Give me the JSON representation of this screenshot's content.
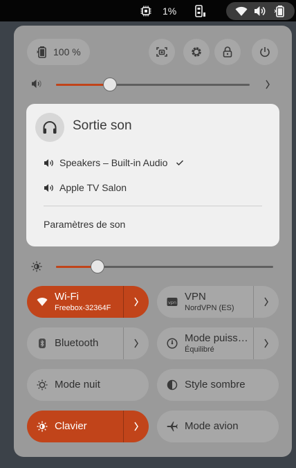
{
  "topbar": {
    "battery_percent": "1%",
    "icons": [
      "cpu-icon",
      "usb-drive-icon",
      "wifi-icon",
      "volume-icon",
      "battery-icon"
    ]
  },
  "quick_settings": {
    "battery": {
      "label": "100 %",
      "icon": "battery-icon"
    },
    "header_buttons": [
      "screenshot-icon",
      "settings-icon",
      "lock-icon",
      "power-icon"
    ],
    "volume": {
      "level": 0.28,
      "icon": "volume-icon"
    },
    "brightness": {
      "level": 0.19,
      "icon": "brightness-icon"
    }
  },
  "sound_output": {
    "title": "Sortie son",
    "devices": [
      {
        "label": "Speakers – Built-in Audio",
        "selected": true
      },
      {
        "label": "Apple TV Salon",
        "selected": false
      }
    ],
    "settings_label": "Paramètres de son"
  },
  "toggles": {
    "wifi": {
      "label": "Wi-Fi",
      "sub": "Freebox-32364F",
      "active": true
    },
    "vpn": {
      "label": "VPN",
      "sub": "NordVPN (ES)",
      "active": false
    },
    "bluetooth": {
      "label": "Bluetooth",
      "active": false
    },
    "power_mode": {
      "label": "Mode puiss…",
      "sub": "Équilibré",
      "active": false
    },
    "night_mode": {
      "label": "Mode nuit",
      "active": false
    },
    "dark_style": {
      "label": "Style sombre",
      "active": false
    },
    "keyboard": {
      "label": "Clavier",
      "active": true
    },
    "airplane": {
      "label": "Mode avion",
      "active": false
    }
  },
  "colors": {
    "accent": "#c1441a",
    "panel": "#9a9a9a",
    "popup": "#f0f0f0",
    "topbar": "#050505"
  }
}
